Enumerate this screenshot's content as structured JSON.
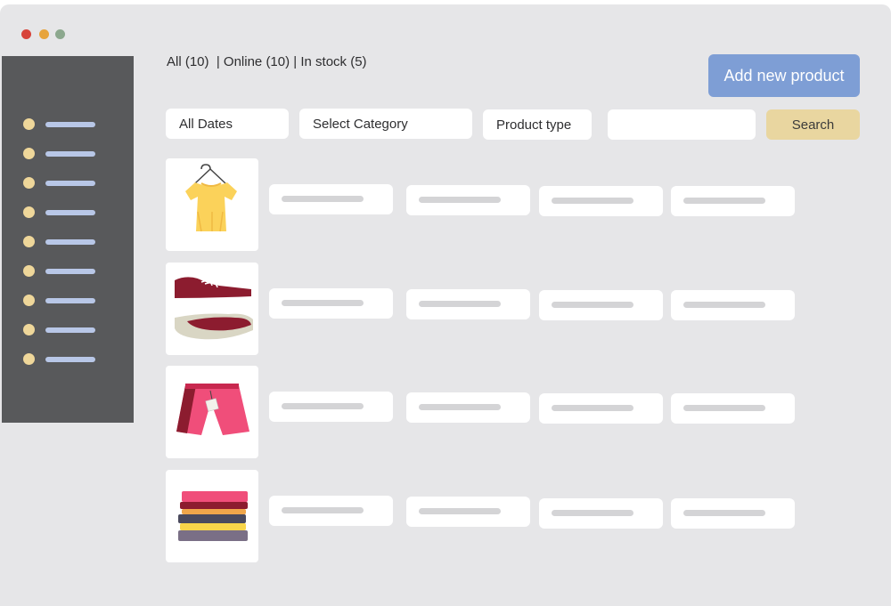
{
  "window": {
    "controls": [
      "close",
      "minimize",
      "maximize"
    ]
  },
  "sidebar": {
    "item_count": 9
  },
  "filters": {
    "tabs_text": "All (10)  | Online (10) | In stock (5)",
    "dates_label": "All Dates",
    "category_label": "Select Category",
    "product_type_label": "Product type",
    "search_value": "",
    "search_button_label": "Search"
  },
  "toolbar": {
    "add_product_label": "Add new product"
  },
  "products": [
    {
      "image": "yellow-shirt-on-hanger-icon"
    },
    {
      "image": "red-sneakers-icon"
    },
    {
      "image": "pink-shorts-with-tag-icon"
    },
    {
      "image": "folded-clothes-stack-icon"
    }
  ],
  "colors": {
    "window_bg": "#e6e6e8",
    "sidebar_bg": "#58595b",
    "add_button": "#7e9ed5",
    "search_button": "#e9d6a0",
    "sidebar_bullet": "#efd79a",
    "sidebar_bar": "#b8c7e7"
  }
}
